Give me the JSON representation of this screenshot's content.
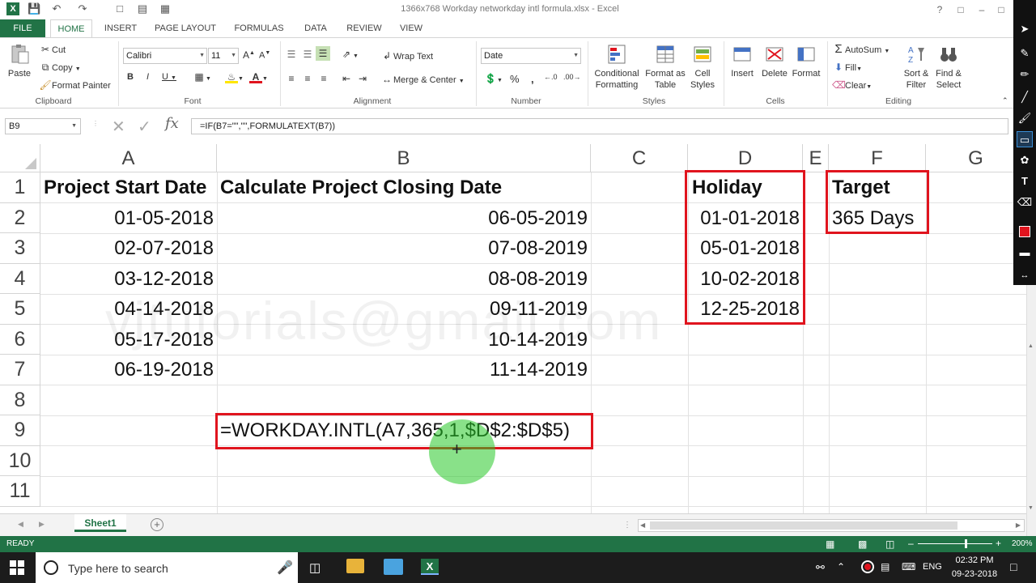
{
  "window": {
    "title": "1366x768   Workday networkday intl formula.xlsx - Excel"
  },
  "tabs": [
    "FILE",
    "HOME",
    "INSERT",
    "PAGE LAYOUT",
    "FORMULAS",
    "DATA",
    "REVIEW",
    "VIEW"
  ],
  "ribbon": {
    "clipboard": {
      "paste": "Paste",
      "cut": "Cut",
      "copy": "Copy",
      "format_painter": "Format Painter",
      "label": "Clipboard"
    },
    "font": {
      "name": "Calibri",
      "size": "11",
      "label": "Font"
    },
    "alignment": {
      "wrap": "Wrap Text",
      "merge": "Merge & Center",
      "label": "Alignment"
    },
    "number": {
      "format": "Date",
      "label": "Number"
    },
    "styles": {
      "cond": "Conditional Formatting",
      "table": "Format as Table",
      "cell": "Cell Styles",
      "label": "Styles"
    },
    "cells": {
      "insert": "Insert",
      "delete": "Delete",
      "format": "Format",
      "label": "Cells"
    },
    "editing": {
      "autosum": "AutoSum",
      "fill": "Fill",
      "clear": "Clear",
      "sort": "Sort & Filter",
      "find": "Find & Select",
      "label": "Editing"
    }
  },
  "formula_bar": {
    "name_box": "B9",
    "fx": "fx",
    "formula": "=IF(B7=\"\",\"\",FORMULATEXT(B7))"
  },
  "columns": [
    "A",
    "B",
    "C",
    "D",
    "E",
    "F",
    "G"
  ],
  "rows": [
    "1",
    "2",
    "3",
    "4",
    "5",
    "6",
    "7",
    "8",
    "9",
    "10",
    "11"
  ],
  "cells": {
    "a1": "Project Start Date",
    "b1": "Calculate Project Closing Date",
    "d1": "Holiday",
    "f1": "Target",
    "f2": "365 Days",
    "start_dates": [
      "01-05-2018",
      "02-07-2018",
      "03-12-2018",
      "04-14-2018",
      "05-17-2018",
      "06-19-2018"
    ],
    "closing_dates": [
      "06-05-2019",
      "07-08-2019",
      "08-08-2019",
      "09-11-2019",
      "10-14-2019",
      "11-14-2019"
    ],
    "holidays": [
      "01-01-2018",
      "05-01-2018",
      "10-02-2018",
      "12-25-2018"
    ],
    "b9": "=WORKDAY.INTL(A7,365,1,$D$2:$D$5)"
  },
  "watermark": "vjtutorials@gmail.com",
  "sheet_tab": "Sheet1",
  "status": {
    "ready": "READY",
    "zoom": "200%"
  },
  "taskbar": {
    "search_placeholder": "Type here to search",
    "lang": "ENG",
    "time": "02:32 PM",
    "date": "09-23-2018"
  },
  "colors": {
    "excel_green": "#217346",
    "highlight_red": "#e0141e"
  }
}
